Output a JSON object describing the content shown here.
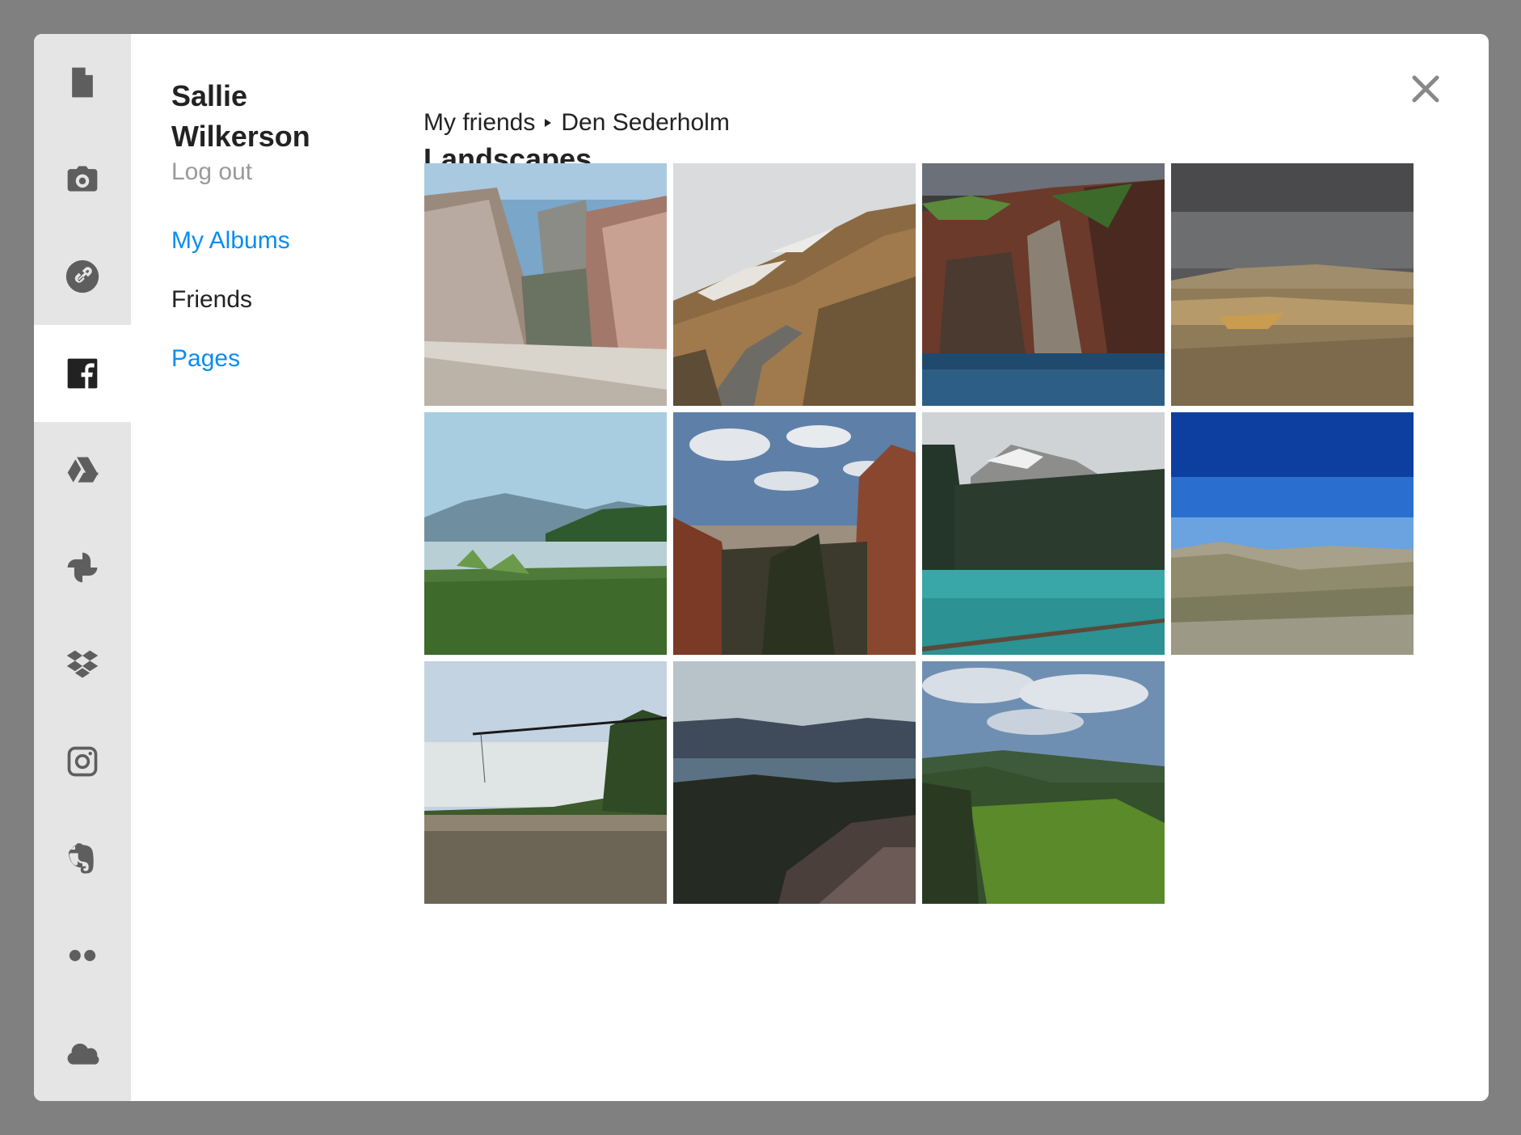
{
  "sidebar": {
    "items": [
      {
        "icon": "file-icon",
        "active": false
      },
      {
        "icon": "camera-icon",
        "active": false
      },
      {
        "icon": "link-icon",
        "active": false
      },
      {
        "icon": "facebook-icon",
        "active": true
      },
      {
        "icon": "google-drive-icon",
        "active": false
      },
      {
        "icon": "google-photos-icon",
        "active": false
      },
      {
        "icon": "dropbox-icon",
        "active": false
      },
      {
        "icon": "instagram-icon",
        "active": false
      },
      {
        "icon": "evernote-icon",
        "active": false
      },
      {
        "icon": "flickr-icon",
        "active": false
      },
      {
        "icon": "onedrive-icon",
        "active": false
      }
    ]
  },
  "user": {
    "name": "Sallie Wilkerson",
    "logout_label": "Log out"
  },
  "nav": {
    "my_albums": "My Albums",
    "friends": "Friends",
    "pages": "Pages"
  },
  "breadcrumb": {
    "items": [
      "My friends",
      "Den Sederholm"
    ]
  },
  "album": {
    "title": "Landscapes",
    "photo_count": 11
  },
  "colors": {
    "link": "#0a8cf0",
    "rail_bg": "#e6e5e6",
    "overlay": "#808080"
  }
}
